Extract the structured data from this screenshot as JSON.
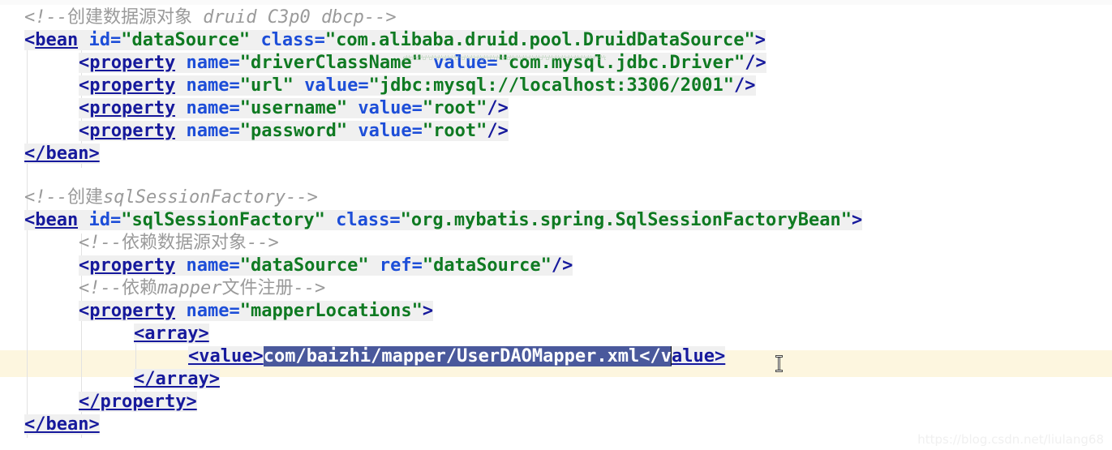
{
  "editor": {
    "language": "xml",
    "current_line_number": 12,
    "colors": {
      "background": "#ffffff",
      "tag": "#16199c",
      "attribute": "#1d4ed8",
      "value": "#0f7a22",
      "comment": "#9a9a9a",
      "selection": "#4a599c",
      "current_line": "#fdf6df",
      "token_background": "#f0f0f0",
      "indent_guide": "#e2e2e2",
      "warning_squiggle": "#9fc39f"
    }
  },
  "watermark": {
    "text": "https://blog.csdn.net/liulang68"
  },
  "lines": [
    {
      "id": "l1",
      "type": "comment",
      "comment_open": "<!--",
      "comment_cjk": "创建数据源对象",
      "comment_rest": " druid C3p0 dbcp",
      "comment_close": "-->"
    },
    {
      "id": "l2",
      "type": "tag_open",
      "open": "<",
      "tagname": "bean",
      "attr1_name": "id",
      "attr1_value": "\"dataSource\"",
      "attr2_name": "class",
      "attr2_value": "\"com.alibaba.druid.pool.DruidDataSource\"",
      "close": ">"
    },
    {
      "id": "l3",
      "type": "property",
      "open": "<",
      "tagname": "property",
      "attr1_name": "name",
      "attr1_value": "\"driverClassName\"",
      "attr2_name": "value",
      "attr2_value": "\"com.mysql.jdbc.Driver\"",
      "close": "/>"
    },
    {
      "id": "l4",
      "type": "property",
      "open": "<",
      "tagname": "property",
      "attr1_name": "name",
      "attr1_value": "\"url\"",
      "attr2_name": "value",
      "attr2_value": "\"jdbc:mysql://localhost:3306/2001\"",
      "close": "/>"
    },
    {
      "id": "l5",
      "type": "property",
      "open": "<",
      "tagname": "property",
      "attr1_name": "name",
      "attr1_value": "\"username\"",
      "attr2_name": "value",
      "attr2_value": "\"root\"",
      "close": "/>"
    },
    {
      "id": "l6",
      "type": "property",
      "open": "<",
      "tagname": "property",
      "attr1_name": "name",
      "attr1_value": "\"password\"",
      "attr2_name": "value",
      "attr2_value": "\"root\"",
      "close": "/>"
    },
    {
      "id": "l7",
      "type": "tag_close",
      "text": "</bean>"
    },
    {
      "id": "l8",
      "type": "blank",
      "text": ""
    },
    {
      "id": "l9",
      "type": "comment",
      "comment_open": "<!--",
      "comment_cjk": "创建",
      "comment_rest": "sqlSessionFactory",
      "comment_close": "-->"
    },
    {
      "id": "l10",
      "type": "tag_open",
      "open": "<",
      "tagname": "bean",
      "attr1_name": "id",
      "attr1_value": "\"sqlSessionFactory\"",
      "attr2_name": "class",
      "attr2_value": "\"org.mybatis.spring.SqlSessionFactoryBean\"",
      "close": ">"
    },
    {
      "id": "l11",
      "type": "comment",
      "comment_open": "<!--",
      "comment_cjk": "依赖数据源对象",
      "comment_rest": "",
      "comment_close": "-->"
    },
    {
      "id": "l12",
      "type": "property",
      "open": "<",
      "tagname": "property",
      "attr1_name": "name",
      "attr1_value": "\"dataSource\"",
      "attr2_name": "ref",
      "attr2_value": "\"dataSource\"",
      "close": "/>"
    },
    {
      "id": "l13",
      "type": "comment",
      "comment_open": "<!--",
      "comment_cjk": "依赖",
      "comment_rest": "mapper",
      "comment_cjk2": "文件注册",
      "comment_close": "-->"
    },
    {
      "id": "l14",
      "type": "property_open",
      "open": "<",
      "tagname": "property",
      "attr1_name": "name",
      "attr1_value": "\"mapperLocations\"",
      "close": ">"
    },
    {
      "id": "l15",
      "type": "tag_simple",
      "text": "<array>"
    },
    {
      "id": "l16",
      "type": "value_line",
      "prefix": "<value>",
      "selected_text": "com/baizhi/mapper/UserDAOMapper.xml</v",
      "suffix": "alue>"
    },
    {
      "id": "l17",
      "type": "tag_simple",
      "text": "</array>"
    },
    {
      "id": "l18",
      "type": "tag_simple",
      "text": "</property>"
    },
    {
      "id": "l19",
      "type": "tag_close",
      "text": "</bean>"
    }
  ]
}
